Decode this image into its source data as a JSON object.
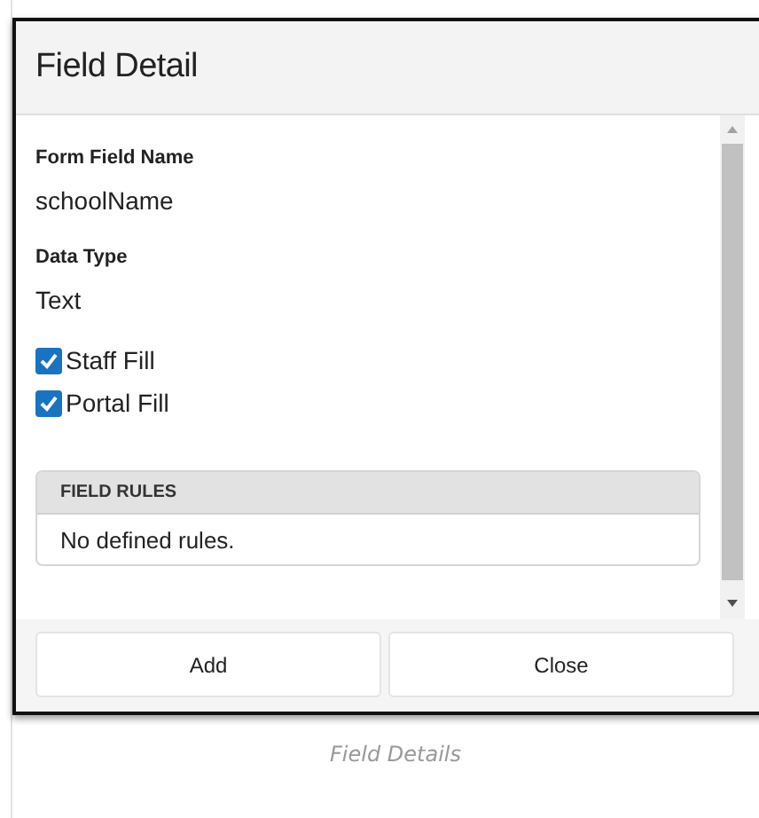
{
  "dialog": {
    "title": "Field Detail",
    "fields": [
      {
        "label": "Form Field Name",
        "value": "schoolName"
      },
      {
        "label": "Data Type",
        "value": "Text"
      }
    ],
    "checkboxes": [
      {
        "label": "Staff Fill",
        "checked": true
      },
      {
        "label": "Portal Fill",
        "checked": true
      }
    ],
    "rules_panel": {
      "heading": "FIELD RULES",
      "empty_text": "No defined rules."
    },
    "buttons": [
      "Add",
      "Close"
    ]
  },
  "caption": "Field Details"
}
